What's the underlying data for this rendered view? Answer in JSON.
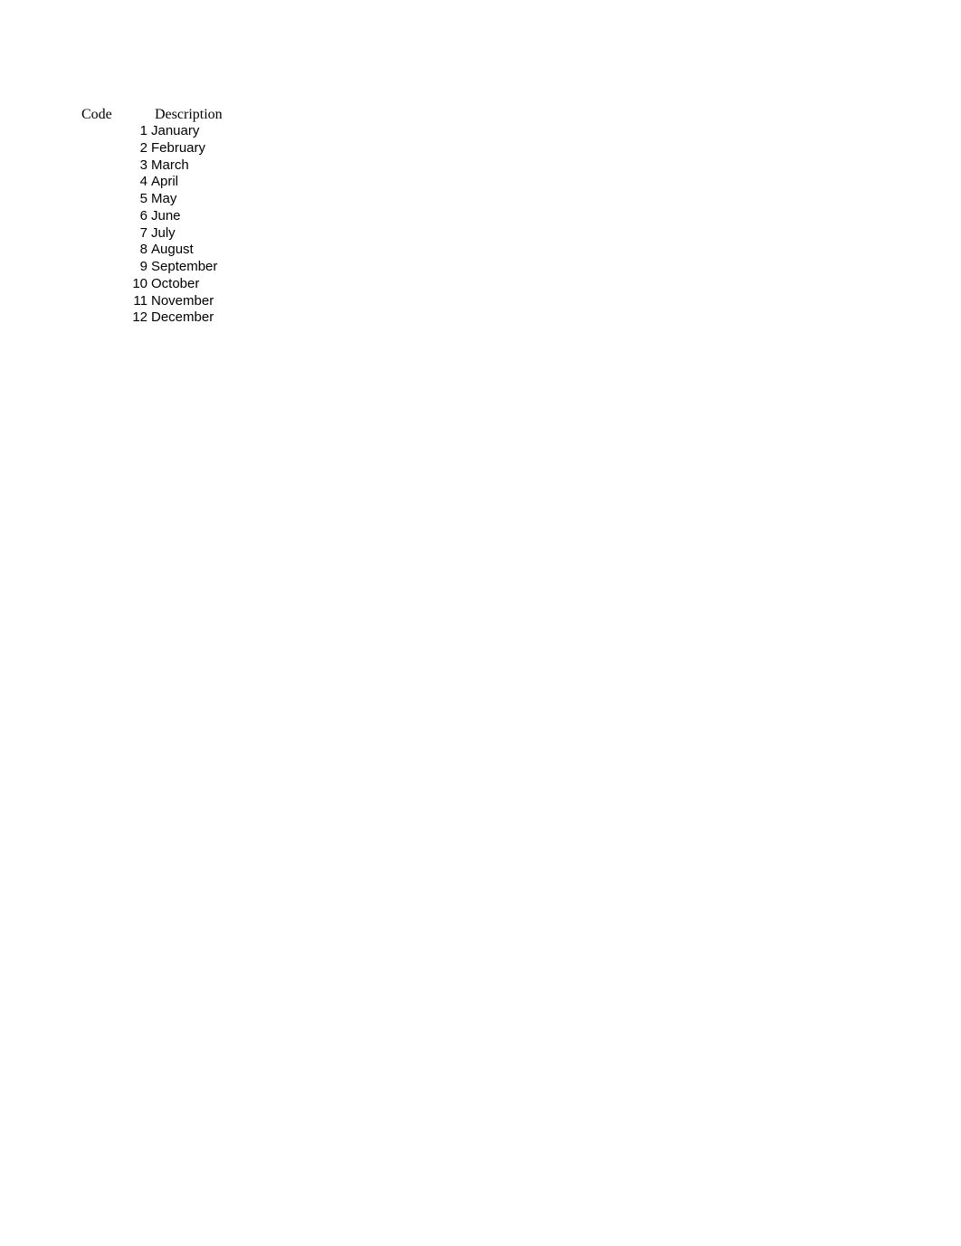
{
  "table": {
    "headers": {
      "code": "Code",
      "description": "Description"
    },
    "rows": [
      {
        "code": "1",
        "description": "January"
      },
      {
        "code": "2",
        "description": "February"
      },
      {
        "code": "3",
        "description": "March"
      },
      {
        "code": "4",
        "description": "April"
      },
      {
        "code": "5",
        "description": "May"
      },
      {
        "code": "6",
        "description": "June"
      },
      {
        "code": "7",
        "description": "July"
      },
      {
        "code": "8",
        "description": "August"
      },
      {
        "code": "9",
        "description": "September"
      },
      {
        "code": "10",
        "description": "October"
      },
      {
        "code": "11",
        "description": "November"
      },
      {
        "code": "12",
        "description": "December"
      }
    ]
  }
}
